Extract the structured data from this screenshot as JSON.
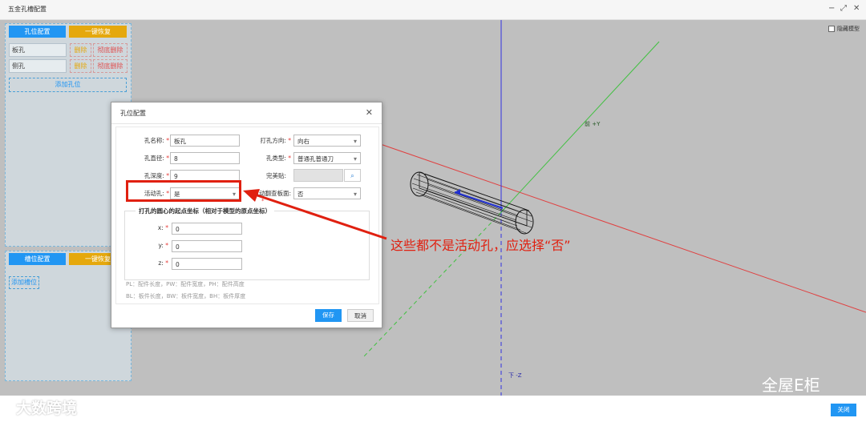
{
  "window": {
    "title": "五金孔槽配置",
    "controls": [
      "−",
      "⤢",
      "✕"
    ]
  },
  "left_panel": {
    "hole_config_tab": "孔位配置",
    "restore_tab": "一键恢复",
    "holes": [
      {
        "name": "板孔",
        "delete": "删除",
        "purge": "彻底删除"
      },
      {
        "name": "侧孔",
        "delete": "删除",
        "purge": "彻底删除"
      }
    ],
    "add_hole": "添加孔位",
    "slot_config_tab": "槽位配置",
    "slot_restore_tab": "一键恢复",
    "add_slot": "添加槽位"
  },
  "viewport": {
    "hide_model_label": "隐藏模型",
    "axis_y_label": "前 +Y",
    "axis_z_label": "下 -Z",
    "colors": {
      "background": "#bfbfbf",
      "x_axis": "#e04040",
      "y_axis": "#40c040",
      "z_axis": "#3030e0"
    }
  },
  "dialog": {
    "title": "孔位配置",
    "fields": {
      "hole_name": {
        "label": "孔名称:",
        "value": "板孔"
      },
      "diameter": {
        "label": "孔直径:",
        "value": "8"
      },
      "depth": {
        "label": "孔深度:",
        "value": "9"
      },
      "active": {
        "label": "活动孔:",
        "value": "是"
      },
      "direction": {
        "label": "打孔方向:",
        "value": "向右"
      },
      "hole_type": {
        "label": "孔类型:",
        "value": "普通孔普通刀"
      },
      "perfect_fit": {
        "label": "完美贴:",
        "value": ""
      },
      "auto_flip": {
        "label": "自动翻查板面:",
        "value": "否"
      }
    },
    "required_mark": "*",
    "origin_group": {
      "title": "打孔的圆心的起点坐标（相对于模型的原点坐标）",
      "x": {
        "label": "x:",
        "value": "0"
      },
      "y": {
        "label": "y:",
        "value": "0"
      },
      "z": {
        "label": "z:",
        "value": "0"
      }
    },
    "hint1": "PL：配件长度，PW：配件宽度，PH：配件高度",
    "hint2": "BL：板件长度，BW：板件宽度，BH：板件厚度",
    "save": "保存",
    "cancel": "取消"
  },
  "annotation": {
    "text": "这些都不是活动孔，应选择“否”"
  },
  "footer": {
    "close": "关闭"
  },
  "watermarks": {
    "brand": "全屋E柜",
    "source": "大数跨境"
  }
}
